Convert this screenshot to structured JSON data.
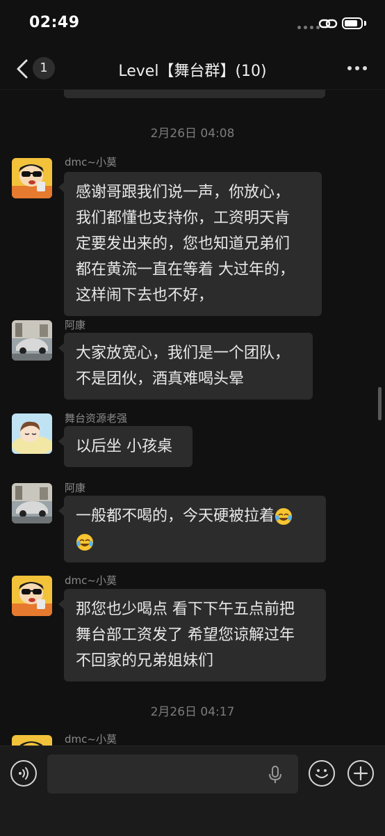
{
  "status_bar": {
    "time": "02:49"
  },
  "header": {
    "unread_count": "1",
    "title": "Level【舞台群】(10)"
  },
  "chat": {
    "timestamps": [
      "2月26日 04:08",
      "2月26日 04:17"
    ],
    "messages": [
      {
        "sender": "dmc~小莫",
        "lines": [
          "感谢哥跟我们说一声，你放心，",
          "我们都懂也支持你，工资明天肯",
          "定要发出来的，您也知道兄弟们",
          "都在黄流一直在等着 大过年的，",
          "这样闹下去也不好，"
        ]
      },
      {
        "sender": "阿康",
        "lines": [
          "大家放宽心，我们是一个团队，",
          "不是团伙，酒真难喝头晕"
        ]
      },
      {
        "sender": "舞台资源老强",
        "lines": [
          "以后坐 小孩桌"
        ]
      },
      {
        "sender": "阿康",
        "lines": [
          "一般都不喝的，今天硬被拉着"
        ],
        "emoji": "face-with-tears-of-joy"
      },
      {
        "sender": "dmc~小莫",
        "lines": [
          "那您也少喝点 看下下午五点前把",
          "舞台部工资发了 希望您谅解过年",
          "不回家的兄弟姐妹们"
        ]
      },
      {
        "sender": "dmc~小莫",
        "lines": []
      }
    ]
  },
  "input_bar": {
    "placeholder": ""
  },
  "colors": {
    "background": "#111111",
    "bubble": "#2c2c2c",
    "timestamp": "#7c7c7c",
    "sender": "#8a8a8a"
  }
}
